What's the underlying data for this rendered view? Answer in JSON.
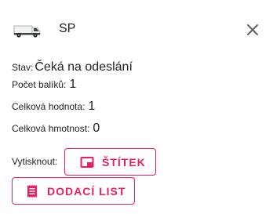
{
  "header": {
    "icon": "van-icon",
    "carrier": "SP",
    "close_icon": "close-icon"
  },
  "details": {
    "status_label": "Stav:",
    "status_value": "Čeká na odeslání",
    "packages_label": "Počet balíků:",
    "packages_value": "1",
    "total_value_label": "Celková hodnota:",
    "total_value_value": "1",
    "total_weight_label": "Celková hmotnost:",
    "total_weight_value": "0"
  },
  "print": {
    "label": "Vytisknout:",
    "label_button": "ŠTÍTEK",
    "label_button_icon": "label-icon",
    "delivery_note_button": "DODACÍ LIST",
    "delivery_note_button_icon": "receipt-icon"
  },
  "colors": {
    "accent": "#e91e63",
    "text": "#212121",
    "close": "#616161"
  }
}
